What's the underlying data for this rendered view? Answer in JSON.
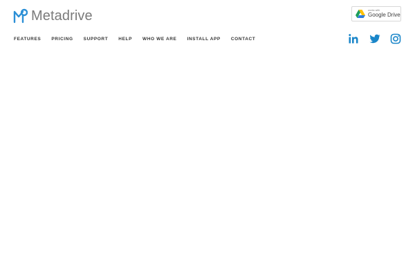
{
  "header": {
    "brand": "Metadrive",
    "logo_color": "#2b8fd6",
    "badge": {
      "small_text": "works with",
      "big_text": "Google Drive"
    }
  },
  "nav": {
    "items": [
      {
        "label": "FEATURES"
      },
      {
        "label": "PRICING"
      },
      {
        "label": "SUPPORT"
      },
      {
        "label": "HELP"
      },
      {
        "label": "WHO WE ARE"
      },
      {
        "label": "INSTALL APP"
      },
      {
        "label": "CONTACT"
      }
    ]
  },
  "social": {
    "icon_color": "#1a86c9",
    "icons": [
      "linkedin-icon",
      "twitter-icon",
      "instagram-icon"
    ]
  }
}
